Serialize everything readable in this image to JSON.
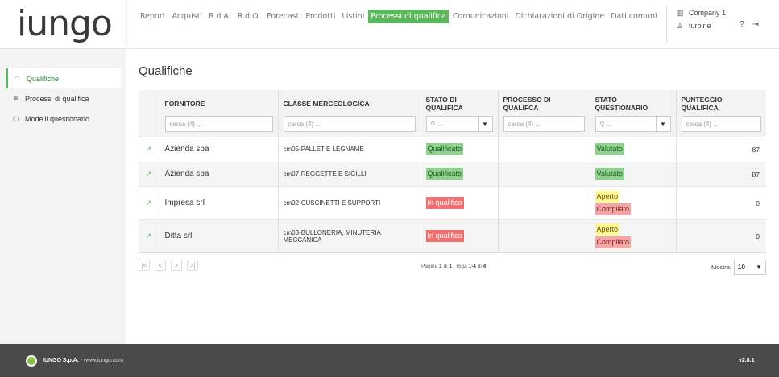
{
  "logo": "iungo",
  "nav": [
    "Report",
    "Acquisti",
    "R.d.A.",
    "R.d.O.",
    "Forecast",
    "Prodotti",
    "Listini",
    "Processi di qualifica",
    "Comunicazioni",
    "Dichiarazioni di Origine",
    "Dati comuni"
  ],
  "nav_active": "Processi di qualifica",
  "company": {
    "name": "Company 1",
    "user": "turbine"
  },
  "sidebar": {
    "items": [
      {
        "label": "Qualifiche",
        "icon": "eye-icon"
      },
      {
        "label": "Processi di qualifica",
        "icon": "sliders-icon"
      },
      {
        "label": "Modelli questionario",
        "icon": "document-icon"
      }
    ]
  },
  "page_title": "Qualifiche",
  "table": {
    "headers": [
      "FORNITORE",
      "CLASSE MERCEOLOGICA",
      "STATO DI QUALIFICA",
      "PROCESSO DI QUALIFCA",
      "STATO QUESTIONARIO",
      "PUNTEGGIO QUALIFICA"
    ],
    "filter_placeholder": "cerca (4) ...",
    "select_placeholder": "...",
    "rows": [
      {
        "supplier": "Azienda spa",
        "class": "cm05-PALLET E LEGNAME",
        "status": "Qualificato",
        "process": "",
        "questionnaire": [
          "Valutato"
        ],
        "score": "87"
      },
      {
        "supplier": "Azienda spa",
        "class": "cm07-REGGETTE E SIGILLI",
        "status": "Qualificato",
        "process": "",
        "questionnaire": [
          "Valutato"
        ],
        "score": "87"
      },
      {
        "supplier": "Impresa srl",
        "class": "cm02-CUSCINETTI E SUPPORTI",
        "status": "In qualifica",
        "process": "",
        "questionnaire": [
          "Aperto",
          "Compilato"
        ],
        "score": "0"
      },
      {
        "supplier": "Ditta srl",
        "class": "cm03-BULLONERIA, MINUTERIA MECCANICA",
        "status": "In qualifica",
        "process": "",
        "questionnaire": [
          "Aperto",
          "Compilato"
        ],
        "score": "0"
      }
    ]
  },
  "pagination": {
    "label_page": "Pagina",
    "page": "1",
    "of": "di",
    "total_pages": "1",
    "label_row": "Riga",
    "rows": "1-4",
    "total_rows": "4"
  },
  "show": {
    "label": "Mostra:",
    "value": "10"
  },
  "footer": {
    "company": "IUNGO S.p.A.",
    "site": " - www.iungo.com",
    "version": "v2.8.1"
  },
  "colors": {
    "accent": "#5cb85c",
    "qualified": "#8fd18f",
    "in_progress": "#f07070",
    "open": "#fff79a",
    "compiled": "#f4a6a6"
  }
}
